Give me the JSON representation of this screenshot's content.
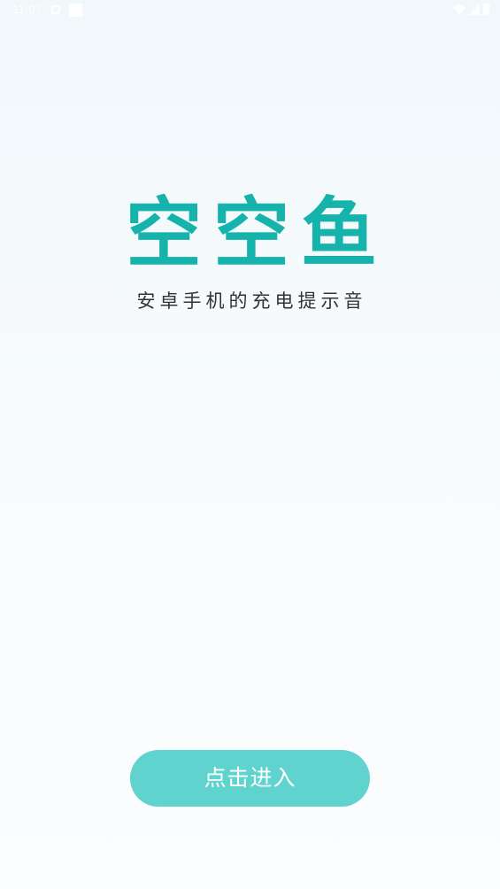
{
  "status_bar": {
    "time": "11:07"
  },
  "logo": {
    "chars": [
      "空",
      "空",
      "鱼"
    ],
    "color": "#16b3ad"
  },
  "tagline": "安卓手机的充电提示音",
  "enter_button": {
    "label": "点击进入",
    "color": "#61d3cf"
  }
}
